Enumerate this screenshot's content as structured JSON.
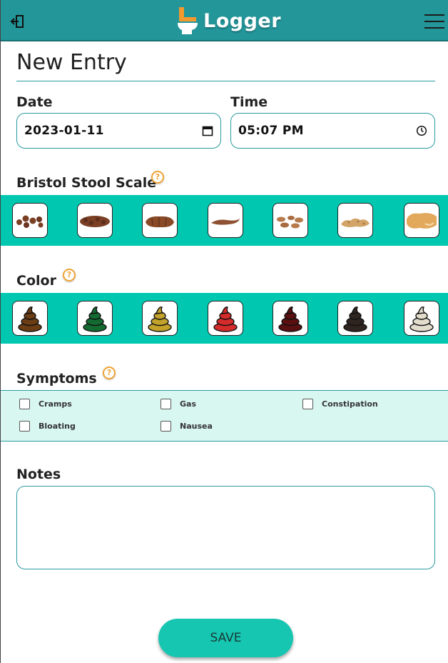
{
  "app": {
    "title": "Logger"
  },
  "page": {
    "title": "New Entry"
  },
  "date": {
    "label": "Date",
    "value": "2023-01-11"
  },
  "time": {
    "label": "Time",
    "value": "05:07 PM"
  },
  "bristol": {
    "label": "Bristol Stool Scale",
    "help": "?",
    "types": [
      "type-1-icon",
      "type-2-icon",
      "type-3-icon",
      "type-4-icon",
      "type-5-icon",
      "type-6-icon",
      "type-7-icon"
    ]
  },
  "color": {
    "label": "Color",
    "help": "?",
    "swatches": [
      "#6b3d14",
      "#146b32",
      "#c2a22a",
      "#d42b2b",
      "#5a0f10",
      "#2e2520",
      "#e2dccd"
    ]
  },
  "symptoms": {
    "label": "Symptoms",
    "help": "?",
    "items": [
      "Cramps",
      "Gas",
      "Constipation",
      "Bloating",
      "Nausea"
    ]
  },
  "notes": {
    "label": "Notes",
    "placeholder": ""
  },
  "actions": {
    "save": "SAVE"
  },
  "colors": {
    "header": "#23969a",
    "band": "#00c8b0",
    "accent": "#2a9aa0",
    "symptom_bg": "#d9f7f1",
    "help": "#f0a437"
  }
}
